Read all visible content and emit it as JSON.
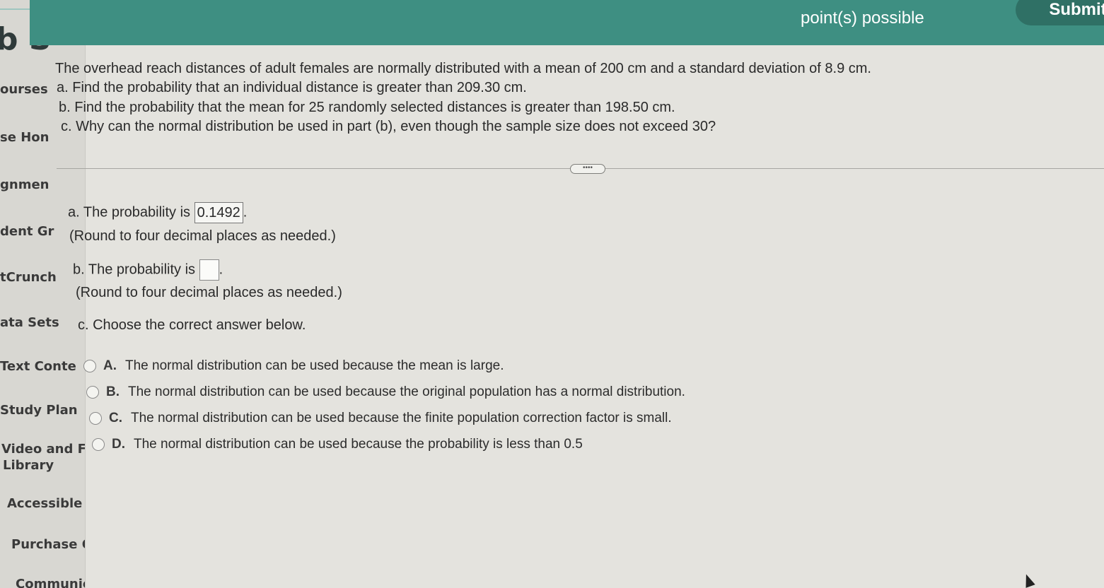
{
  "header": {
    "points_label": "point(s) possible",
    "submit_label": "Submit"
  },
  "sidebar": {
    "brand": "b S",
    "items": [
      {
        "label": "ourses"
      },
      {
        "label": "se Hon"
      },
      {
        "label": "gnmen"
      },
      {
        "label": "dent Gr"
      },
      {
        "label": "tCrunch"
      },
      {
        "label": "ata Sets"
      },
      {
        "label": "Text Conte"
      },
      {
        "label": "Study Plan"
      },
      {
        "label": "Video and F"
      },
      {
        "label": "Library"
      },
      {
        "label": "Accessible I"
      },
      {
        "label": "Purchase O"
      },
      {
        "label": "Communic"
      }
    ]
  },
  "question": {
    "stem": "The overhead reach distances of adult females are normally distributed with a mean of 200 cm and a standard deviation of 8.9 cm.",
    "part_a": "a. Find the probability that an individual distance is greater than 209.30 cm.",
    "part_b": "b. Find the probability that the mean for 25 randomly selected distances is greater than 198.50 cm.",
    "part_c": "c. Why can the normal distribution be used in part (b), even though the sample size does not exceed 30?",
    "more_label": "••••"
  },
  "answers": {
    "a_prefix": "a. The probability is",
    "a_value": "0.1492",
    "a_suffix": ".",
    "a_hint": "(Round to four decimal places as needed.)",
    "b_prefix": "b. The probability is",
    "b_suffix": ".",
    "b_hint": "(Round to four decimal places as needed.)",
    "c_prompt": "c. Choose the correct answer below.",
    "options": [
      {
        "letter": "A.",
        "text": "The normal distribution can be used because the mean is large."
      },
      {
        "letter": "B.",
        "text": "The normal distribution can be used because the original population has a normal distribution."
      },
      {
        "letter": "C.",
        "text": "The normal distribution can be used because the finite population correction factor is small."
      },
      {
        "letter": "D.",
        "text": "The normal distribution can be used because the probability is less than 0.5"
      }
    ]
  }
}
